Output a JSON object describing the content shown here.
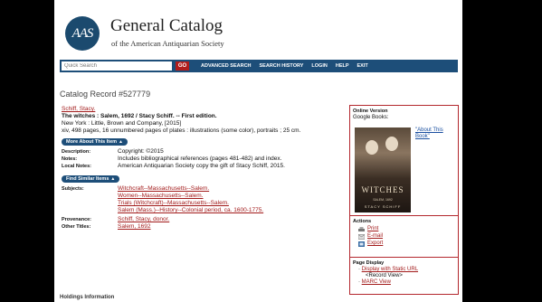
{
  "header": {
    "logo_text": "AAS",
    "title": "General Catalog",
    "subtitle": "of the American Antiquarian Society"
  },
  "nav": {
    "search_placeholder": "Quick Search",
    "go_label": "GO",
    "links": [
      "ADVANCED SEARCH",
      "SEARCH HISTORY",
      "LOGIN",
      "HELP",
      "EXIT"
    ]
  },
  "record": {
    "heading": "Catalog Record #527779",
    "author": "Schiff, Stacy.",
    "title_line": "The witches : Salem, 1692 / Stacy Schiff. -- First edition.",
    "publication": "New York : Little, Brown and Company, [2015]",
    "physical": "xiv, 498 pages, 16 unnumbered pages of plates : illustrations (some color), portraits ; 25 cm.",
    "more_about_label": "More About This Item",
    "description_label": "Description:",
    "description": "Copyright: ©2015",
    "notes_label": "Notes:",
    "notes": "Includes bibliographical references (pages 481-482) and index.",
    "local_notes_label": "Local Notes:",
    "local_notes": "American Antiquarian Society copy the gift of Stacy Schiff, 2015.",
    "find_similar_label": "Find Similar Items",
    "subjects_label": "Subjects:",
    "subjects": [
      "Witchcraft--Massachusetts--Salem.",
      "Women--Massachusetts--Salem.",
      "Trials (Witchcraft)--Massachusetts--Salem.",
      "Salem (Mass.)--History--Colonial period, ca. 1600-1775."
    ],
    "provenance_label": "Provenance:",
    "provenance": "Schiff, Stacy, donor.",
    "other_titles_label": "Other Titles:",
    "other_titles": "Salem, 1692"
  },
  "sidebar": {
    "online_heading": "Online Version",
    "google_books": "Google Books:",
    "about_link": "\"About This Book\"",
    "cover": {
      "title": "WITCHES",
      "subtitle": "SALEM, 1692",
      "author": "STACY SCHIFF"
    },
    "actions_heading": "Actions",
    "actions": [
      "Print",
      "E-mail",
      "Export"
    ],
    "display_heading": "Page Display",
    "display_static": "Display with Static URL",
    "display_record": "<Record View>",
    "display_marc": "MARC View"
  },
  "footer": {
    "holdings": "Holdings Information"
  },
  "colors": {
    "navy": "#1d4e79",
    "accent_red": "#b3272d",
    "link_red": "#a21a1a"
  }
}
